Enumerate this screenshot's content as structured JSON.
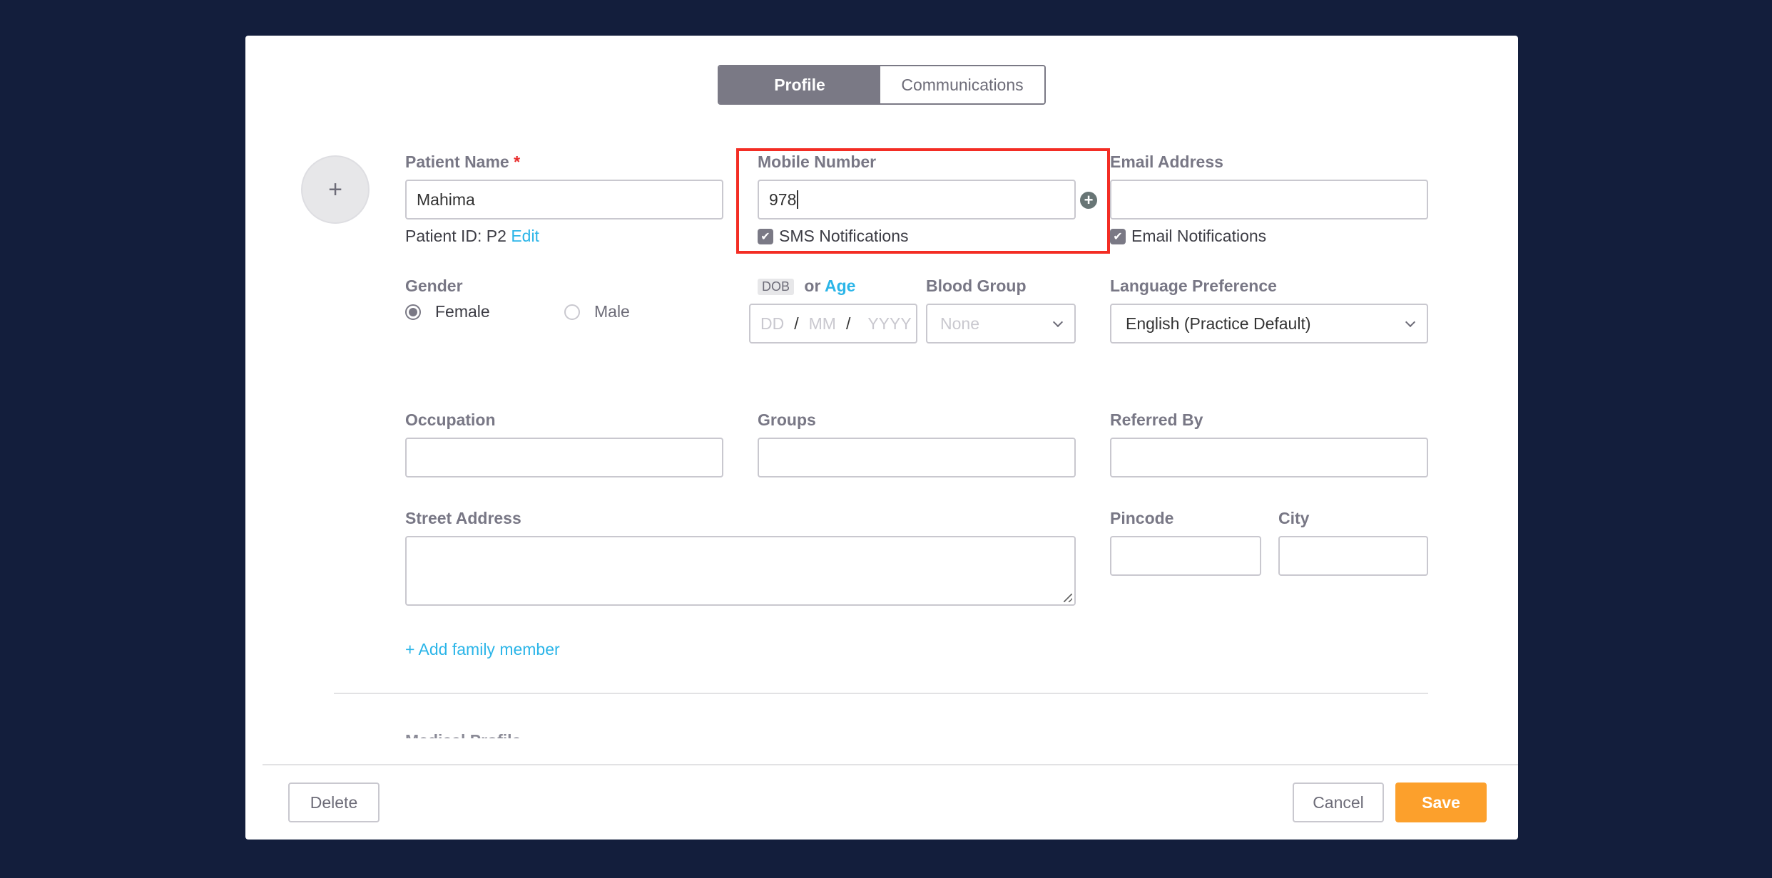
{
  "tabs": [
    {
      "label": "Profile",
      "active": true
    },
    {
      "label": "Communications",
      "active": false
    }
  ],
  "avatar": {
    "icon": "plus-icon",
    "glyph": "+"
  },
  "patient_name": {
    "label": "Patient Name",
    "required_mark": "*",
    "value": "Mahima"
  },
  "patient_id": {
    "prefix": "Patient ID: P2",
    "edit_link": "Edit"
  },
  "mobile": {
    "label": "Mobile Number",
    "value": "978",
    "add_icon": "plus-circle-icon",
    "add_glyph": "+"
  },
  "sms_notifications": {
    "label": "SMS Notifications",
    "checked": true,
    "glyph": "✔"
  },
  "email": {
    "label": "Email Address",
    "value": ""
  },
  "email_notifications": {
    "label": "Email Notifications",
    "checked": true,
    "glyph": "✔"
  },
  "gender": {
    "label": "Gender",
    "options": [
      {
        "label": "Female",
        "selected": true
      },
      {
        "label": "Male",
        "selected": false
      }
    ]
  },
  "dob": {
    "badge": "DOB",
    "or_text": "or",
    "age_link": "Age",
    "dd_placeholder": "DD",
    "mm_placeholder": "MM",
    "yyyy_placeholder": "YYYY",
    "separator": "/"
  },
  "blood_group": {
    "label": "Blood Group",
    "selected": "None"
  },
  "language": {
    "label": "Language Preference",
    "selected": "English (Practice Default)"
  },
  "occupation": {
    "label": "Occupation",
    "value": ""
  },
  "groups": {
    "label": "Groups",
    "value": ""
  },
  "referred_by": {
    "label": "Referred By",
    "value": ""
  },
  "street_address": {
    "label": "Street Address",
    "value": ""
  },
  "pincode": {
    "label": "Pincode",
    "value": ""
  },
  "city": {
    "label": "City",
    "value": ""
  },
  "add_family": {
    "label": "+ Add family member"
  },
  "next_section": {
    "title": "Medical Profile"
  },
  "footer": {
    "delete_label": "Delete",
    "cancel_label": "Cancel",
    "save_label": "Save"
  },
  "colors": {
    "accent": "#2bb5e8",
    "primary_button": "#fca02c",
    "tab_active": "#7a7985",
    "highlight": "#f32d24",
    "backdrop": "#131e3c"
  }
}
